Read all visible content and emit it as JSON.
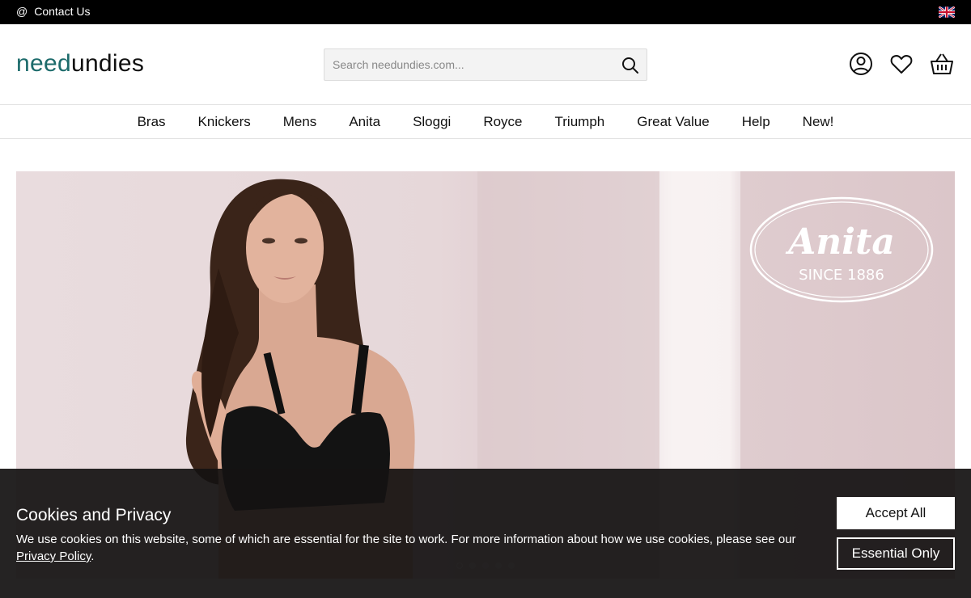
{
  "topbar": {
    "contact_icon": "at-icon",
    "contact_label": "Contact Us",
    "language_icon": "uk-flag-icon"
  },
  "header": {
    "logo_part1": "need",
    "logo_part2": "undies",
    "logo_color": "#1c6b6b",
    "search_placeholder": "Search needundies.com...",
    "search_icon": "search-icon",
    "icons": [
      "account-icon",
      "heart-icon",
      "basket-icon"
    ]
  },
  "nav": {
    "items": [
      "Bras",
      "Knickers",
      "Mens",
      "Anita",
      "Sloggi",
      "Royce",
      "Triumph",
      "Great Value",
      "Help",
      "New!"
    ]
  },
  "hero": {
    "brand_name": "Anita",
    "brand_since": "SINCE 1886",
    "slide_count": 5,
    "active_slide": 1
  },
  "cookie_banner": {
    "title": "Cookies and Privacy",
    "text_before_link": "We use cookies on this website, some of which are essential for the site to work. For more information about how we use cookies, please see our ",
    "link_label": "Privacy Policy",
    "text_after_link": ".",
    "accept_label": "Accept All",
    "essential_label": "Essential Only"
  }
}
